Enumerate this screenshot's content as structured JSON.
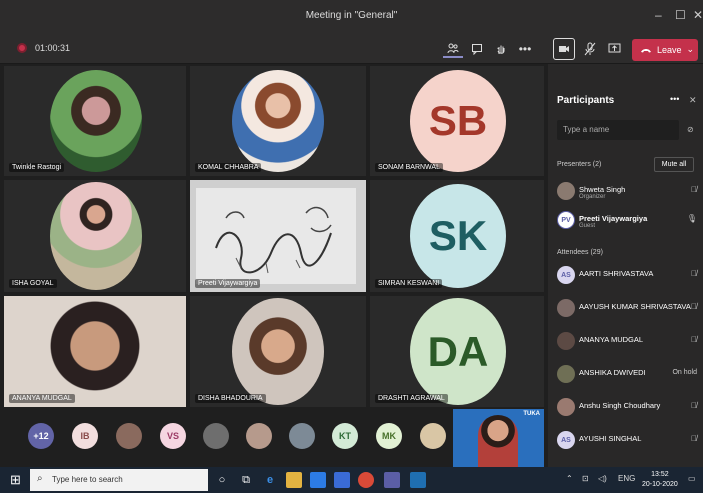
{
  "window": {
    "title": "Meeting in \"General\"",
    "minimize": "–",
    "maximize": "☐",
    "close": "✕"
  },
  "toolbar": {
    "timer": "01:00:31",
    "more": "•••",
    "leave_label": "Leave",
    "leave_chevron": "⌄"
  },
  "tiles": [
    {
      "name": "Twinkle Rastogi",
      "type": "photo",
      "bg": "#5a8a55"
    },
    {
      "name": "KOMAL CHHABRA",
      "type": "photo",
      "bg": "#c79a83"
    },
    {
      "name": "SONAM BARNWAL",
      "type": "initials",
      "initials": "SB",
      "bg": "#f5d3cb",
      "fg": "#a4372a"
    },
    {
      "name": "ISHA GOYAL",
      "type": "photo",
      "bg": "#c8a496"
    },
    {
      "name": "Preeti Vijaywargiya",
      "type": "drawing",
      "bg": "#d9d9d9"
    },
    {
      "name": "SIMRAN KESWANI",
      "type": "initials",
      "initials": "SK",
      "bg": "#c7e6e8",
      "fg": "#1e5e62"
    },
    {
      "name": "ANANYA MUDGAL",
      "type": "photo",
      "bg": "#d3c7bb"
    },
    {
      "name": "DISHA BHADOURIA",
      "type": "photo",
      "bg": "#b58f77"
    },
    {
      "name": "DRASHTI AGRAWAL",
      "type": "initials",
      "initials": "DA",
      "bg": "#cfe5c9",
      "fg": "#2b5a28"
    }
  ],
  "strip": [
    {
      "label": "+12",
      "bg": "#6264a7",
      "fg": "#ffffff"
    },
    {
      "label": "IB",
      "bg": "#f2dede",
      "fg": "#8a4b4b"
    },
    {
      "label": "",
      "bg": "#8a6a5e",
      "fg": "#ffffff"
    },
    {
      "label": "VS",
      "bg": "#f5d6e1",
      "fg": "#9c3b66"
    },
    {
      "label": "",
      "bg": "#6e6e6e",
      "fg": "#ffffff"
    },
    {
      "label": "",
      "bg": "#b69a8c",
      "fg": "#ffffff"
    },
    {
      "label": "",
      "bg": "#7d8a96",
      "fg": "#ffffff"
    },
    {
      "label": "KT",
      "bg": "#d3ead6",
      "fg": "#2e6b37"
    },
    {
      "label": "MK",
      "bg": "#e2f1d4",
      "fg": "#47702a"
    },
    {
      "label": "",
      "bg": "#d9c6a5",
      "fg": "#ffffff"
    }
  ],
  "pip_badge": "TUKA",
  "participants": {
    "title": "Participants",
    "more": "•••",
    "close": "✕",
    "search_placeholder": "Type a name",
    "presenters_header": "Presenters (2)",
    "mute_all": "Mute all",
    "presenters": [
      {
        "name": "Shweta Singh",
        "role": "Organizer",
        "avatar": "",
        "status": "🎤"
      },
      {
        "name": "Preeti Vijaywargiya",
        "role": "Guest",
        "avatar": "PV",
        "status": "🎤"
      }
    ],
    "attendees_header": "Attendees (29)",
    "attendees": [
      {
        "name": "AARTI SHRIVASTAVA",
        "avatar": "AS",
        "status": "🎤"
      },
      {
        "name": "AAYUSH KUMAR SHRIVASTAVA",
        "avatar": "",
        "status": "🎤"
      },
      {
        "name": "ANANYA MUDGAL",
        "avatar": "",
        "status": "🎤"
      },
      {
        "name": "ANSHIKA DWIVEDI",
        "avatar": "",
        "status": "On hold"
      },
      {
        "name": "Anshu Singh Choudhary",
        "avatar": "",
        "status": "🎤"
      },
      {
        "name": "AYUSHI SINGHAL",
        "avatar": "AS",
        "status": "🎤"
      }
    ]
  },
  "taskbar": {
    "start": "⊞",
    "search_placeholder": "Type here to search",
    "lang": "ENG",
    "time": "13:52",
    "date": "20-10-2020"
  }
}
